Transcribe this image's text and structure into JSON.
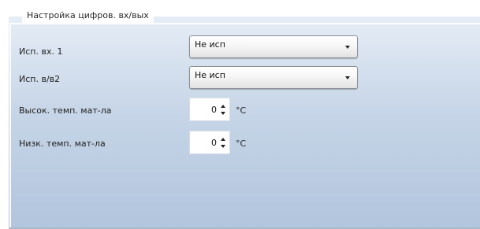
{
  "group": {
    "title": "Настройка цифров. вх/вых"
  },
  "rows": [
    {
      "label": "Исп. вх. 1",
      "type": "select",
      "value": "Не исп"
    },
    {
      "label": "Исп. в/в2",
      "type": "select",
      "value": "Не исп"
    },
    {
      "label": "Высок. темп. мат-ла",
      "type": "spinner",
      "value": "0",
      "unit": "°C"
    },
    {
      "label": "Низк. темп. мат-ла",
      "type": "spinner",
      "value": "0",
      "unit": "°C"
    }
  ],
  "colors": {
    "panel_top": "#e6edf6",
    "panel_bottom": "#b2c5dd"
  },
  "icons": {
    "combo_arrow": "chevron-down-icon",
    "spin_up": "arrow-up-icon",
    "spin_down": "arrow-down-icon"
  }
}
